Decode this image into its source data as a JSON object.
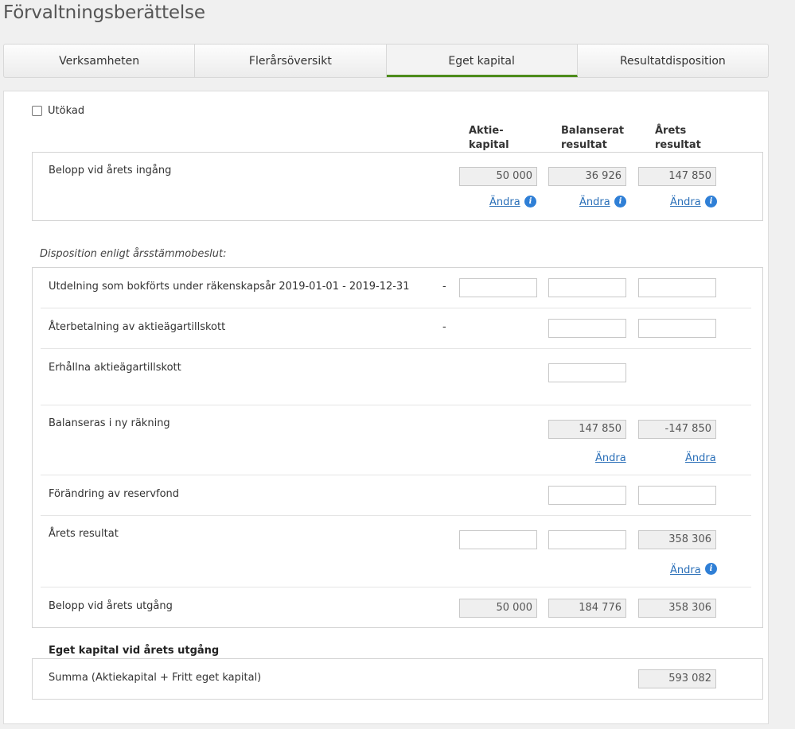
{
  "page_title": "Förvaltningsberättelse",
  "tabs": [
    "Verksamheten",
    "Flerårsöversikt",
    "Eget kapital",
    "Resultatdisposition"
  ],
  "active_tab": 2,
  "utokad_label": "Utökad",
  "col_headers": [
    "Aktie-\nkapital",
    "Balanserat\nresultat",
    "Årets\nresultat"
  ],
  "opening": {
    "label": "Belopp vid årets ingång",
    "values": [
      "50 000",
      "36 926",
      "147 850"
    ],
    "link": "Ändra"
  },
  "disposition_title": "Disposition enligt årsstämmobeslut:",
  "rows": {
    "dividend": {
      "label": "Utdelning som bokförts under räkenskapsår 2019-01-01 - 2019-12-31",
      "dash": "-"
    },
    "repayment": {
      "label": "Återbetalning av aktieägartillskott",
      "dash": "-"
    },
    "received": {
      "label": "Erhållna aktieägartillskott"
    },
    "carried": {
      "label": "Balanseras i ny räkning",
      "values": [
        "147 850",
        "-147 850"
      ],
      "link": "Ändra"
    },
    "reserve": {
      "label": "Förändring av reservfond"
    },
    "result": {
      "label": "Årets resultat",
      "value": "358 306",
      "link": "Ändra"
    },
    "closing": {
      "label": "Belopp vid årets utgång",
      "values": [
        "50 000",
        "184 776",
        "358 306"
      ]
    }
  },
  "equity_title": "Eget kapital vid årets utgång",
  "sum": {
    "label": "Summa (Aktiekapital + Fritt eget kapital)",
    "value": "593 082"
  },
  "info_icon_glyph": "i"
}
